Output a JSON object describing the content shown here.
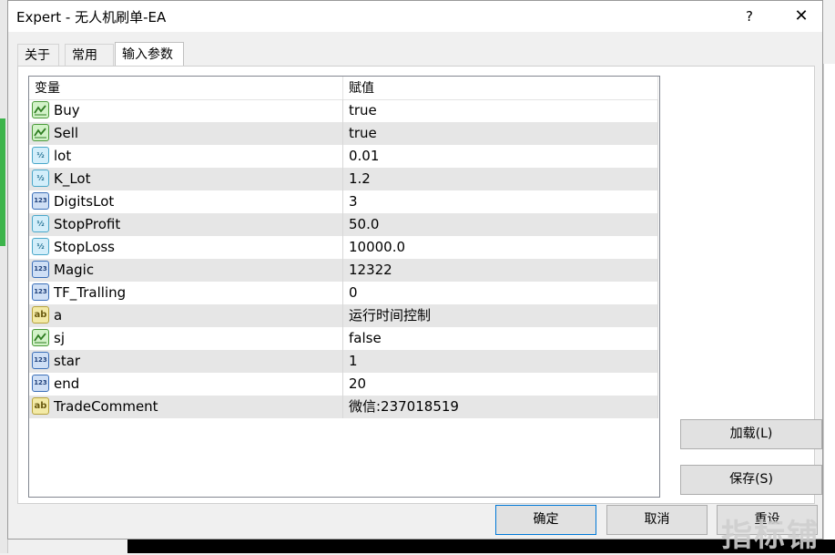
{
  "window": {
    "title": "Expert - 无人机刷单-EA",
    "help": "?",
    "close": "✕"
  },
  "tabs": [
    "关于",
    "常用",
    "输入参数"
  ],
  "table": {
    "headers": {
      "name": "变量",
      "value": "赋值"
    },
    "rows": [
      {
        "type": "bool",
        "icon_text": "",
        "name": "Buy",
        "value": "true"
      },
      {
        "type": "bool",
        "icon_text": "",
        "name": "Sell",
        "value": "true"
      },
      {
        "type": "double",
        "icon_text": "½",
        "name": "lot",
        "value": "0.01"
      },
      {
        "type": "double",
        "icon_text": "½",
        "name": "K_Lot",
        "value": "1.2"
      },
      {
        "type": "int",
        "icon_text": "123",
        "name": "DigitsLot",
        "value": "3"
      },
      {
        "type": "double",
        "icon_text": "½",
        "name": "StopProfit",
        "value": "50.0"
      },
      {
        "type": "double",
        "icon_text": "½",
        "name": "StopLoss",
        "value": "10000.0"
      },
      {
        "type": "int",
        "icon_text": "123",
        "name": "Magic",
        "value": "12322"
      },
      {
        "type": "int",
        "icon_text": "123",
        "name": "TF_Tralling",
        "value": "0"
      },
      {
        "type": "string",
        "icon_text": "ab",
        "name": "a",
        "value": "运行时间控制"
      },
      {
        "type": "bool",
        "icon_text": "",
        "name": "sj",
        "value": "false"
      },
      {
        "type": "int",
        "icon_text": "123",
        "name": "star",
        "value": "1"
      },
      {
        "type": "int",
        "icon_text": "123",
        "name": "end",
        "value": "20"
      },
      {
        "type": "string",
        "icon_text": "ab",
        "name": "TradeComment",
        "value": "微信:237018519"
      }
    ]
  },
  "buttons": {
    "load": "加载(L)",
    "save": "保存(S)",
    "ok": "确定",
    "cancel": "取消",
    "reset": "重设"
  },
  "watermark": "指标铺"
}
